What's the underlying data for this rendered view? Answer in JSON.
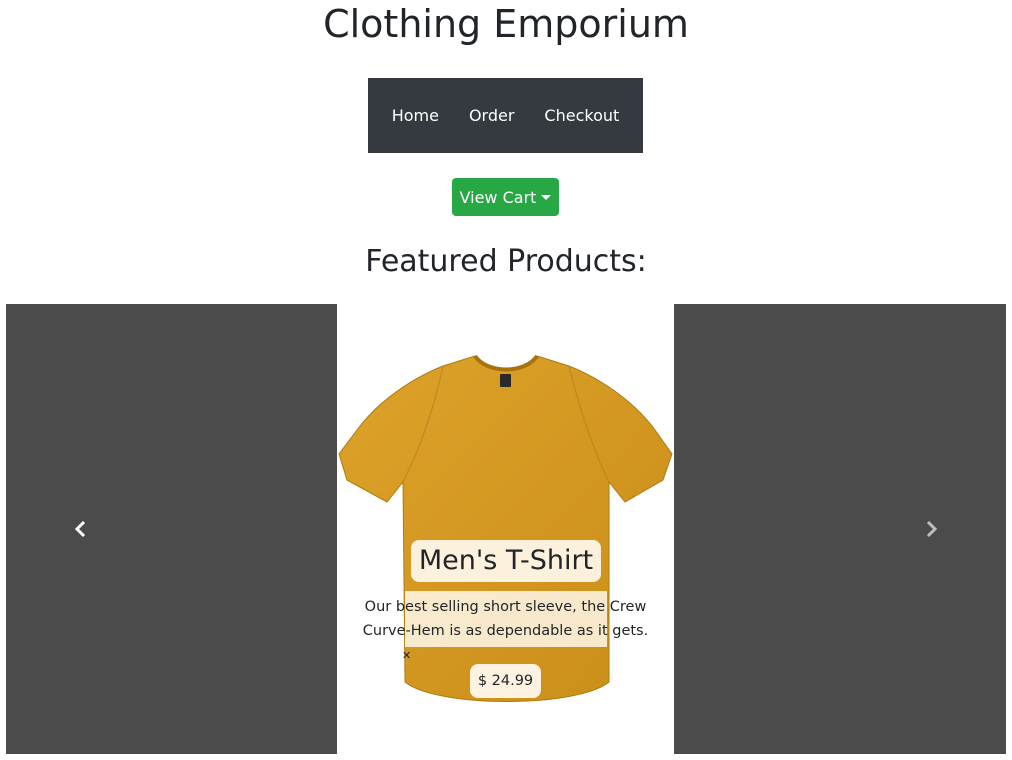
{
  "site": {
    "title": "Clothing Emporium"
  },
  "nav": {
    "items": [
      "Home",
      "Order",
      "Checkout"
    ]
  },
  "cart": {
    "label": "View Cart"
  },
  "featured": {
    "heading": "Featured Products:"
  },
  "carousel": {
    "prev_icon": "chevron-left-icon",
    "next_icon": "chevron-right-icon",
    "slide": {
      "name": "Men's T-Shirt",
      "description": "Our best selling short sleeve, the Crew Curve-Hem is as dependable as it gets.",
      "price": "$ 24.99",
      "image": "mustard-tshirt-image",
      "shirt_color": "#D4991F"
    }
  },
  "colors": {
    "navbar": "#343a40",
    "cart_button": "#28a745",
    "carousel_side": "#4b4b4b"
  }
}
